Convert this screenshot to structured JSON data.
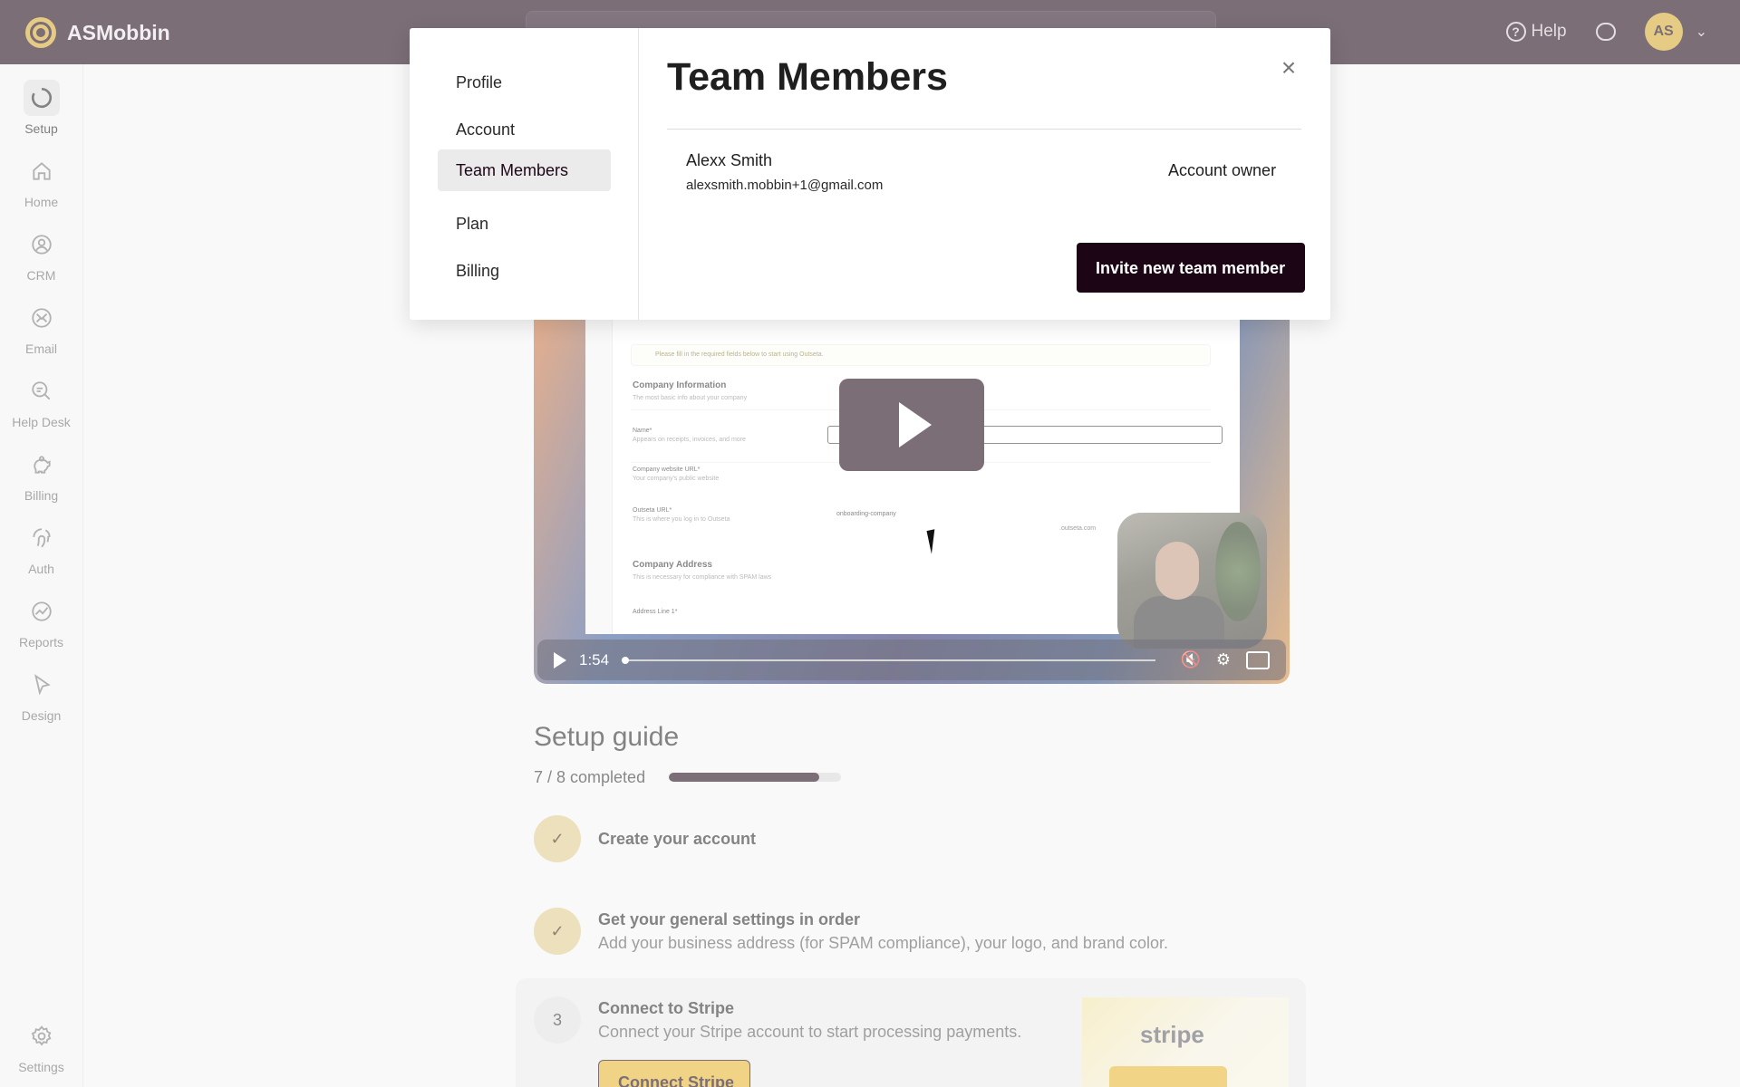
{
  "app": {
    "name": "ASMobbin"
  },
  "topbar": {
    "help_label": "Help",
    "help_icon": "question-circle-icon",
    "messages_icon": "chat-bubbles-icon",
    "avatar_initials": "AS"
  },
  "sidebar": {
    "items": [
      {
        "label": "Setup",
        "icon": "setup-ring-icon",
        "active": true
      },
      {
        "label": "Home",
        "icon": "home-icon"
      },
      {
        "label": "CRM",
        "icon": "user-circle-icon"
      },
      {
        "label": "Email",
        "icon": "mail-icon"
      },
      {
        "label": "Help Desk",
        "icon": "chat-icon"
      },
      {
        "label": "Billing",
        "icon": "piggy-bank-icon"
      },
      {
        "label": "Auth",
        "icon": "fingerprint-icon"
      },
      {
        "label": "Reports",
        "icon": "chart-icon"
      },
      {
        "label": "Design",
        "icon": "pointer-icon"
      }
    ],
    "settings_label": "Settings"
  },
  "video": {
    "time": "1:54",
    "mini_screen": {
      "notice": "Please fill in the required fields below to start using Outseta.",
      "company_info_title": "Company Information",
      "company_info_sub": "The most basic info about your company",
      "name_label": "Name*",
      "name_sub": "Appears on receipts, invoices, and more",
      "website_label": "Company website URL*",
      "website_sub": "Your company's public website",
      "outseta_label": "Outseta URL*",
      "outseta_sub": "This is where you log in to Outseta",
      "outseta_value": "onboarding-company",
      "outseta_suffix": ".outseta.com",
      "address_title": "Company Address",
      "address_sub": "This is necessary for compliance with SPAM laws",
      "address_line": "Address Line 1*"
    }
  },
  "setup": {
    "title": "Setup guide",
    "progress_text": "7 / 8 completed",
    "progress_fraction": 0.875,
    "steps": [
      {
        "title": "Create your account",
        "status": "done"
      },
      {
        "title": "Get your general settings in order",
        "desc": "Add your business address (for SPAM compliance), your logo, and brand color.",
        "status": "done"
      },
      {
        "number": "3",
        "title": "Connect to Stripe",
        "desc": "Connect your Stripe account to start processing payments.",
        "button": "Connect Stripe",
        "image_word": "stripe"
      }
    ]
  },
  "modal": {
    "nav": [
      {
        "label": "Profile"
      },
      {
        "label": "Account"
      },
      {
        "label": "Team Members",
        "active": true
      },
      {
        "label": "Plan"
      },
      {
        "label": "Billing"
      }
    ],
    "title": "Team Members",
    "member": {
      "name": "Alexx Smith",
      "email": "alexsmith.mobbin+1@gmail.com",
      "role": "Account owner"
    },
    "invite_button": "Invite new team member"
  }
}
